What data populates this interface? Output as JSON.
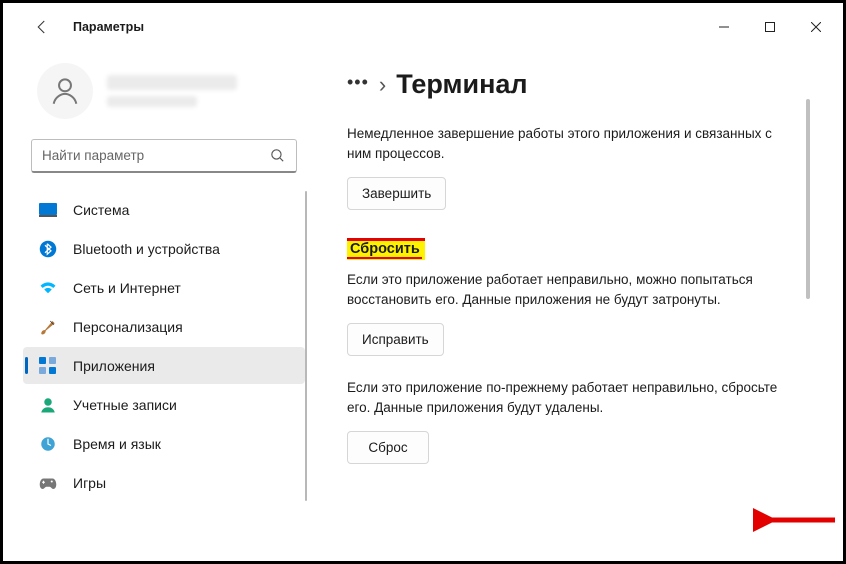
{
  "window": {
    "title": "Параметры"
  },
  "search": {
    "placeholder": "Найти параметр"
  },
  "sidebar": {
    "items": [
      {
        "label": "Система"
      },
      {
        "label": "Bluetooth и устройства"
      },
      {
        "label": "Сеть и Интернет"
      },
      {
        "label": "Персонализация"
      },
      {
        "label": "Приложения"
      },
      {
        "label": "Учетные записи"
      },
      {
        "label": "Время и язык"
      },
      {
        "label": "Игры"
      }
    ]
  },
  "breadcrumb": {
    "title": "Терминал"
  },
  "sections": {
    "terminate": {
      "text": "Немедленное завершение работы этого приложения и связанных с ним процессов.",
      "button": "Завершить"
    },
    "reset": {
      "heading": "Сбросить",
      "repair_text": "Если это приложение работает неправильно, можно попытаться восстановить его. Данные приложения не будут затронуты.",
      "repair_button": "Исправить",
      "reset_text": "Если это приложение по-прежнему работает неправильно, сбросьте его. Данные приложения будут удалены.",
      "reset_button": "Сброс"
    }
  }
}
